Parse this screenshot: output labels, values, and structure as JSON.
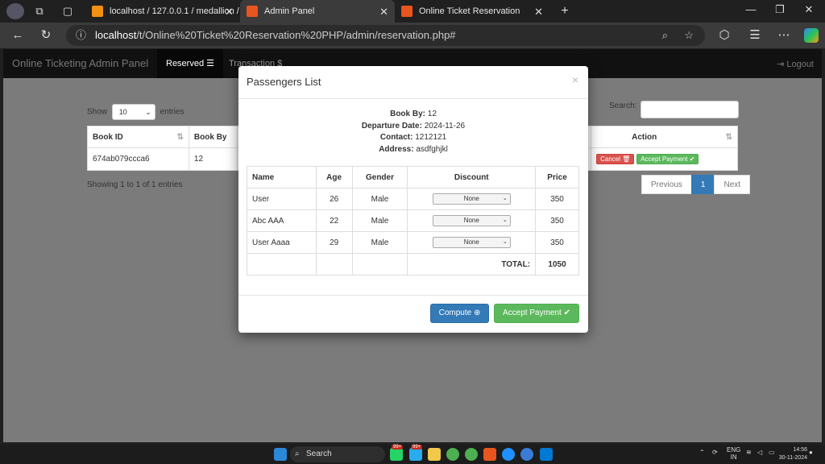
{
  "browser": {
    "tabs": [
      {
        "label": "localhost / 127.0.0.1 / medallion /",
        "active": false
      },
      {
        "label": "Admin Panel",
        "active": true
      },
      {
        "label": "Online Ticket Reservation",
        "active": false
      }
    ],
    "url_host": "localhost",
    "url_path": "/t/Online%20Ticket%20Reservation%20PHP/admin/reservation.php#"
  },
  "navbar": {
    "brand": "Online Ticketing Admin Panel",
    "items": [
      "Reserved",
      "Transaction",
      "Logout"
    ]
  },
  "datatable": {
    "show_label": "Show",
    "entries_label": "entries",
    "page_length": "10",
    "search_label": "Search:",
    "columns": [
      "Book ID",
      "Book By",
      "Action"
    ],
    "row": {
      "book_id": "674ab079ccca6",
      "book_by": "12",
      "cancel": "Cancel",
      "accept": "Accept Payment"
    },
    "info": "Showing 1 to 1 of 1 entries",
    "pagination": [
      "Previous",
      "1",
      "Next"
    ]
  },
  "modal": {
    "title": "Passengers List",
    "close": "×",
    "book_by_label": "Book By:",
    "book_by": "12",
    "departure_label": "Departure Date:",
    "departure": "2024-11-26",
    "contact_label": "Contact:",
    "contact": "1212121",
    "address_label": "Address:",
    "address": "asdfghjkl",
    "columns": [
      "Name",
      "Age",
      "Gender",
      "Discount",
      "Price"
    ],
    "passengers": [
      {
        "name": "User",
        "age": "26",
        "gender": "Male",
        "discount": "None",
        "price": "350"
      },
      {
        "name": "Abc AAA",
        "age": "22",
        "gender": "Male",
        "discount": "None",
        "price": "350"
      },
      {
        "name": "User Aaaa",
        "age": "29",
        "gender": "Male",
        "discount": "None",
        "price": "350"
      }
    ],
    "total_label": "TOTAL:",
    "total": "1050",
    "compute": "Compute",
    "accept": "Accept Payment"
  },
  "taskbar": {
    "search": "Search",
    "badge1": "99+",
    "badge2": "99+",
    "lang1": "ENG",
    "lang2": "IN",
    "time": "14:56",
    "date": "30-11-2024"
  }
}
